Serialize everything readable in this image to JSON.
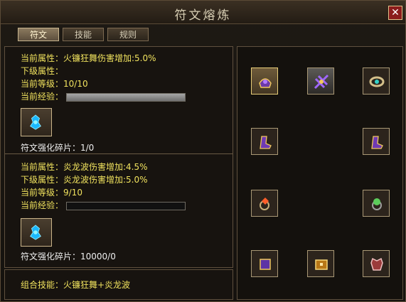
{
  "window": {
    "title": "符文熔炼",
    "close_icon": "close-icon"
  },
  "tabs": [
    {
      "label": "符文",
      "active": true
    },
    {
      "label": "技能",
      "active": false
    },
    {
      "label": "规则",
      "active": false
    }
  ],
  "rune1": {
    "current_attr": "当前属性：火镰狂舞伤害增加:5.0%",
    "next_attr": "下级属性：",
    "level": "当前等级：10/10",
    "exp_label": "当前经验：",
    "exp_progress": 1.0,
    "fragments": "符文强化碎片：1/0"
  },
  "rune2": {
    "current_attr": "当前属性：炎龙波伤害增加:4.5%",
    "next_attr": "下级属性：炎龙波伤害增加:5.0%",
    "level": "当前等级：9/10",
    "exp_label": "当前经验：",
    "exp_progress": 0.0,
    "fragments": "符文强化碎片：10000/0"
  },
  "combo": {
    "text": "组合技能：火镰狂舞+炎龙波"
  },
  "equipment": [
    {
      "icon": "helmet-icon",
      "state": "active"
    },
    {
      "icon": "weapon-icon",
      "state": "gray"
    },
    {
      "icon": "bracelet-icon",
      "state": "normal"
    },
    {
      "icon": "boot-icon",
      "state": "normal"
    },
    {
      "icon": "boot-icon",
      "state": "normal"
    },
    {
      "icon": "ring-red-icon",
      "state": "normal"
    },
    {
      "icon": "ring-green-icon",
      "state": "normal"
    },
    {
      "icon": "belt-icon",
      "state": "normal"
    },
    {
      "icon": "chest-icon",
      "state": "normal"
    },
    {
      "icon": "armor-icon",
      "state": "normal"
    }
  ]
}
